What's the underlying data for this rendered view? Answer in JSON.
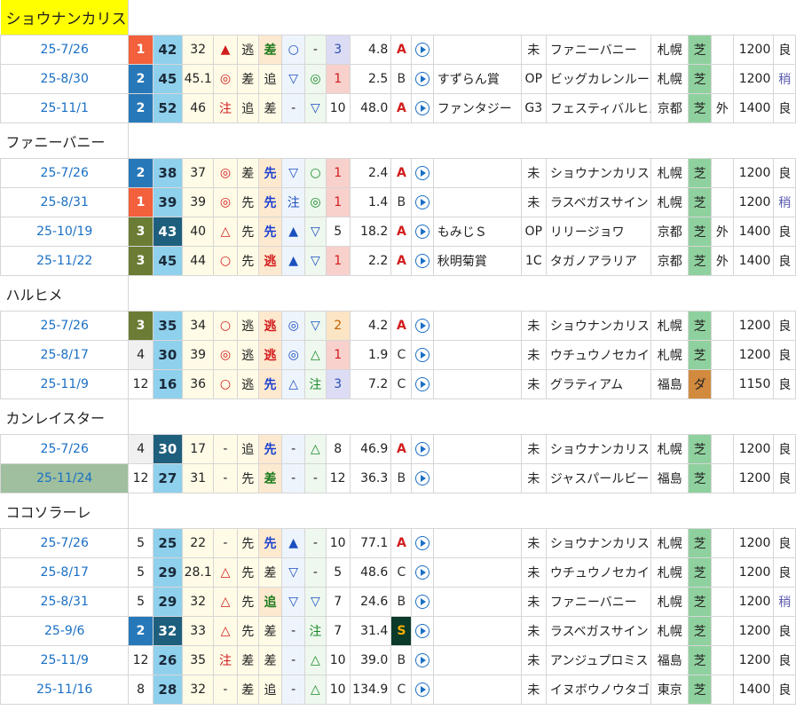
{
  "colors": {
    "rank1": "#f2603c",
    "rank2": "#2778b8",
    "rank3": "#6b7c34",
    "rank_other": "#f0f0f0",
    "idx_light": "#8fd0ec",
    "idx_dark": "#1f5f7e",
    "finish_1_bg": "#f8d0cc",
    "finish_2_bg": "#fbe5c4",
    "finish_3_bg": "#dcdcf4",
    "style_bg": "#fff6d4",
    "mark_bg": "#fff6d4",
    "turf": "#8fd19e",
    "dirt": "#d28a3e"
  },
  "horses": [
    {
      "name": "ショウナンカリス",
      "highlight": true,
      "races": [
        {
          "date": "25-7/26",
          "rank": "1",
          "idx": "42",
          "idx_dark": false,
          "pct": "32",
          "m1": "▲",
          "m1c": "mk-tri-red",
          "pos": "逃",
          "st": "差",
          "stc": "st-sashi",
          "m2": "○",
          "m2c": "mk-circ",
          "m3": "-",
          "m3c": "",
          "fin": "3",
          "odds": "4.8",
          "grade": "A",
          "rname": "",
          "cls": "未",
          "opp": "ファニーバニー",
          "venue": "札幌",
          "surf": "芝",
          "surfc": "surf-shiba",
          "io": "",
          "dist": "1200",
          "cond": "良"
        },
        {
          "date": "25-8/30",
          "rank": "2",
          "idx": "45",
          "idx_dark": false,
          "pct": "45.1",
          "m1": "◎",
          "m1c": "mk-note",
          "pos": "差",
          "st": "追",
          "stc": "",
          "m2": "▽",
          "m2c": "mk-down",
          "m3": "◎",
          "m3c": "mk-dbl",
          "fin": "1",
          "odds": "2.5",
          "grade": "B",
          "rname": "すずらん賞",
          "cls": "OP",
          "opp": "ビッグカレンルーフ",
          "venue": "札幌",
          "surf": "芝",
          "surfc": "surf-shiba",
          "io": "",
          "dist": "1200",
          "cond": "稍"
        },
        {
          "date": "25-11/1",
          "rank": "2",
          "idx": "52",
          "idx_dark": false,
          "pct": "46",
          "m1": "注",
          "m1c": "mk-note",
          "pos": "追",
          "st": "差",
          "stc": "",
          "m2": "-",
          "m2c": "",
          "m3": "▽",
          "m3c": "mk-down",
          "fin": "10",
          "odds": "48.0",
          "grade": "A",
          "rname": "ファンタジー",
          "cls": "G3",
          "opp": "フェスティバルヒル",
          "venue": "京都",
          "surf": "芝",
          "surfc": "surf-shiba",
          "io": "外",
          "dist": "1400",
          "cond": "良"
        }
      ]
    },
    {
      "name": "ファニーバニー",
      "highlight": false,
      "races": [
        {
          "date": "25-7/26",
          "rank": "2",
          "idx": "38",
          "idx_dark": false,
          "pct": "37",
          "m1": "◎",
          "m1c": "mk-note",
          "pos": "差",
          "st": "先",
          "stc": "st-sen",
          "m2": "▽",
          "m2c": "mk-down",
          "m3": "○",
          "m3c": "mk-dbl",
          "fin": "1",
          "odds": "2.4",
          "grade": "A",
          "rname": "",
          "cls": "未",
          "opp": "ショウナンカリス",
          "venue": "札幌",
          "surf": "芝",
          "surfc": "surf-shiba",
          "io": "",
          "dist": "1200",
          "cond": "良"
        },
        {
          "date": "25-8/31",
          "rank": "1",
          "idx": "39",
          "idx_dark": false,
          "pct": "39",
          "m1": "◎",
          "m1c": "mk-note",
          "pos": "先",
          "st": "先",
          "stc": "st-sen",
          "m2": "注",
          "m2c": "mk-down",
          "m3": "◎",
          "m3c": "mk-dbl",
          "fin": "1",
          "odds": "1.4",
          "grade": "B",
          "rname": "",
          "cls": "未",
          "opp": "ラスベガスサイン",
          "venue": "札幌",
          "surf": "芝",
          "surfc": "surf-shiba",
          "io": "",
          "dist": "1200",
          "cond": "稍"
        },
        {
          "date": "25-10/19",
          "rank": "3",
          "idx": "43",
          "idx_dark": true,
          "pct": "40",
          "m1": "△",
          "m1c": "mk-note",
          "pos": "先",
          "st": "先",
          "stc": "st-sen",
          "m2": "▲",
          "m2c": "mk-tri-blue",
          "m3": "▽",
          "m3c": "mk-down",
          "fin": "5",
          "odds": "18.2",
          "grade": "A",
          "rname": "もみじＳ",
          "cls": "OP",
          "opp": "リリージョワ",
          "venue": "京都",
          "surf": "芝",
          "surfc": "surf-shiba",
          "io": "外",
          "dist": "1400",
          "cond": "良"
        },
        {
          "date": "25-11/22",
          "rank": "3",
          "idx": "45",
          "idx_dark": false,
          "pct": "44",
          "m1": "○",
          "m1c": "mk-note",
          "pos": "先",
          "st": "逃",
          "stc": "st-nige",
          "m2": "▲",
          "m2c": "mk-tri-blue",
          "m3": "▽",
          "m3c": "mk-down",
          "fin": "1",
          "odds": "2.2",
          "grade": "A",
          "rname": "秋明菊賞",
          "cls": "1C",
          "opp": "タガノアラリア",
          "venue": "京都",
          "surf": "芝",
          "surfc": "surf-shiba",
          "io": "外",
          "dist": "1400",
          "cond": "良"
        }
      ]
    },
    {
      "name": "ハルヒメ",
      "highlight": false,
      "races": [
        {
          "date": "25-7/26",
          "rank": "3",
          "idx": "35",
          "idx_dark": false,
          "pct": "34",
          "m1": "○",
          "m1c": "mk-note",
          "pos": "逃",
          "st": "逃",
          "stc": "st-nige",
          "m2": "◎",
          "m2c": "mk-circ",
          "m3": "▽",
          "m3c": "mk-down",
          "fin": "2",
          "odds": "4.2",
          "grade": "A",
          "rname": "",
          "cls": "未",
          "opp": "ショウナンカリス",
          "venue": "札幌",
          "surf": "芝",
          "surfc": "surf-shiba",
          "io": "",
          "dist": "1200",
          "cond": "良"
        },
        {
          "date": "25-8/17",
          "rank": "4",
          "idx": "30",
          "idx_dark": false,
          "pct": "39",
          "m1": "◎",
          "m1c": "mk-note",
          "pos": "逃",
          "st": "逃",
          "stc": "st-nige",
          "m2": "◎",
          "m2c": "mk-circ",
          "m3": "△",
          "m3c": "mk-dbl",
          "fin": "1",
          "odds": "1.9",
          "grade": "C",
          "rname": "",
          "cls": "未",
          "opp": "ウチュウノセカイ",
          "venue": "札幌",
          "surf": "芝",
          "surfc": "surf-shiba",
          "io": "",
          "dist": "1200",
          "cond": "良"
        },
        {
          "date": "25-11/9",
          "rank": "12",
          "idx": "16",
          "idx_dark": false,
          "pct": "36",
          "m1": "○",
          "m1c": "mk-note",
          "pos": "逃",
          "st": "先",
          "stc": "st-sen",
          "m2": "△",
          "m2c": "mk-circ",
          "m3": "注",
          "m3c": "mk-dbl",
          "fin": "3",
          "odds": "7.2",
          "grade": "C",
          "rname": "",
          "cls": "未",
          "opp": "グラティアム",
          "venue": "福島",
          "surf": "ダ",
          "surfc": "surf-da",
          "io": "",
          "dist": "1150",
          "cond": "良"
        }
      ]
    },
    {
      "name": "カンレイスター",
      "highlight": false,
      "races": [
        {
          "date": "25-7/26",
          "rank": "4",
          "idx": "30",
          "idx_dark": true,
          "pct": "17",
          "m1": "-",
          "m1c": "",
          "pos": "追",
          "st": "先",
          "stc": "st-sen",
          "m2": "-",
          "m2c": "",
          "m3": "△",
          "m3c": "mk-dbl",
          "fin": "8",
          "odds": "46.9",
          "grade": "A",
          "rname": "",
          "cls": "未",
          "opp": "ショウナンカリス",
          "venue": "札幌",
          "surf": "芝",
          "surfc": "surf-shiba",
          "io": "",
          "dist": "1200",
          "cond": "良"
        },
        {
          "date": "25-11/24",
          "date_hl": true,
          "rank": "12",
          "idx": "27",
          "idx_dark": false,
          "pct": "31",
          "m1": "-",
          "m1c": "",
          "pos": "先",
          "st": "差",
          "stc": "st-sashi",
          "m2": "-",
          "m2c": "",
          "m3": "-",
          "m3c": "",
          "fin": "12",
          "odds": "36.3",
          "grade": "B",
          "rname": "",
          "cls": "未",
          "opp": "ジャスパールビー",
          "venue": "福島",
          "surf": "芝",
          "surfc": "surf-shiba",
          "io": "",
          "dist": "1200",
          "cond": "良"
        }
      ]
    },
    {
      "name": "ココソラーレ",
      "highlight": false,
      "races": [
        {
          "date": "25-7/26",
          "rank": "5",
          "idx": "25",
          "idx_dark": false,
          "pct": "22",
          "m1": "-",
          "m1c": "",
          "pos": "先",
          "st": "先",
          "stc": "st-sen",
          "m2": "▲",
          "m2c": "mk-tri-blue",
          "m3": "-",
          "m3c": "",
          "fin": "10",
          "odds": "77.1",
          "grade": "A",
          "rname": "",
          "cls": "未",
          "opp": "ショウナンカリス",
          "venue": "札幌",
          "surf": "芝",
          "surfc": "surf-shiba",
          "io": "",
          "dist": "1200",
          "cond": "良"
        },
        {
          "date": "25-8/17",
          "rank": "5",
          "idx": "29",
          "idx_dark": false,
          "pct": "28.1",
          "m1": "△",
          "m1c": "mk-note",
          "pos": "先",
          "st": "差",
          "stc": "",
          "m2": "▽",
          "m2c": "mk-down",
          "m3": "-",
          "m3c": "",
          "fin": "5",
          "odds": "48.6",
          "grade": "C",
          "rname": "",
          "cls": "未",
          "opp": "ウチュウノセカイ",
          "venue": "札幌",
          "surf": "芝",
          "surfc": "surf-shiba",
          "io": "",
          "dist": "1200",
          "cond": "良"
        },
        {
          "date": "25-8/31",
          "rank": "5",
          "idx": "29",
          "idx_dark": false,
          "pct": "32",
          "m1": "△",
          "m1c": "mk-note",
          "pos": "先",
          "st": "追",
          "stc": "st-oi",
          "m2": "▽",
          "m2c": "mk-down",
          "m3": "▽",
          "m3c": "mk-down",
          "fin": "7",
          "odds": "24.6",
          "grade": "B",
          "rname": "",
          "cls": "未",
          "opp": "ファニーバニー",
          "venue": "札幌",
          "surf": "芝",
          "surfc": "surf-shiba",
          "io": "",
          "dist": "1200",
          "cond": "稍"
        },
        {
          "date": "25-9/6",
          "rank": "2",
          "idx": "32",
          "idx_dark": true,
          "pct": "33",
          "m1": "△",
          "m1c": "mk-note",
          "pos": "先",
          "st": "差",
          "stc": "",
          "m2": "-",
          "m2c": "",
          "m3": "注",
          "m3c": "mk-dbl",
          "fin": "7",
          "odds": "31.4",
          "grade": "S",
          "rname": "",
          "cls": "未",
          "opp": "ラスベガスサイン",
          "venue": "札幌",
          "surf": "芝",
          "surfc": "surf-shiba",
          "io": "",
          "dist": "1200",
          "cond": "良"
        },
        {
          "date": "25-11/9",
          "rank": "12",
          "idx": "26",
          "idx_dark": false,
          "pct": "35",
          "m1": "注",
          "m1c": "mk-note",
          "pos": "差",
          "st": "差",
          "stc": "",
          "m2": "-",
          "m2c": "",
          "m3": "△",
          "m3c": "mk-dbl",
          "fin": "10",
          "odds": "39.0",
          "grade": "B",
          "rname": "",
          "cls": "未",
          "opp": "アンジュプロミス",
          "venue": "福島",
          "surf": "芝",
          "surfc": "surf-shiba",
          "io": "",
          "dist": "1200",
          "cond": "良"
        },
        {
          "date": "25-11/16",
          "rank": "8",
          "idx": "28",
          "idx_dark": false,
          "pct": "32",
          "m1": "-",
          "m1c": "",
          "pos": "差",
          "st": "追",
          "stc": "",
          "m2": "-",
          "m2c": "",
          "m3": "△",
          "m3c": "mk-dbl",
          "fin": "10",
          "odds": "134.9",
          "grade": "C",
          "rname": "",
          "cls": "未",
          "opp": "イヌボウノウタゴエ",
          "venue": "東京",
          "surf": "芝",
          "surfc": "surf-shiba",
          "io": "",
          "dist": "1400",
          "cond": "良"
        }
      ]
    }
  ]
}
